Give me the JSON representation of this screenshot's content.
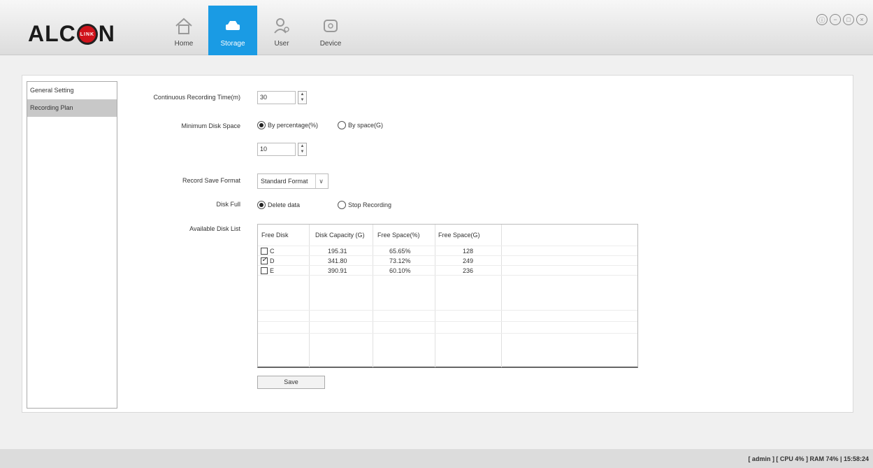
{
  "logo": {
    "brand_left": "ALC",
    "brand_inner": "LINK",
    "brand_right": "N"
  },
  "nav": [
    {
      "label": "Home",
      "icon": "home-icon",
      "active": false
    },
    {
      "label": "Storage",
      "icon": "storage-icon",
      "active": true
    },
    {
      "label": "User",
      "icon": "user-icon",
      "active": false
    },
    {
      "label": "Device",
      "icon": "device-icon",
      "active": false
    }
  ],
  "window_controls": [
    "info-icon",
    "minimize-icon",
    "maximize-icon",
    "close-icon"
  ],
  "sidebar": {
    "items": [
      {
        "label": "General Setting",
        "active": false
      },
      {
        "label": "Recording Plan",
        "active": true
      }
    ]
  },
  "form": {
    "continuous_label": "Continuous Recording Time(m)",
    "continuous_value": "30",
    "min_disk_label": "Minimum Disk Space",
    "min_disk_opt1": "By percentage(%)",
    "min_disk_opt2": "By space(G)",
    "min_disk_value": "10",
    "format_label": "Record Save Format",
    "format_value": "Standard Format",
    "disk_full_label": "Disk Full",
    "disk_full_opt1": "Delete data",
    "disk_full_opt2": "Stop Recording",
    "disk_list_label": "Available Disk List"
  },
  "disk_table": {
    "headers": [
      "Free Disk",
      "Disk Capacity (G)",
      "Free Space(%)",
      "Free Space(G)"
    ],
    "rows": [
      {
        "disk": "C",
        "checked": false,
        "capacity": "195.31",
        "free_pct": "65.65%",
        "free_g": "128"
      },
      {
        "disk": "D",
        "checked": true,
        "capacity": "341.80",
        "free_pct": "73.12%",
        "free_g": "249"
      },
      {
        "disk": "E",
        "checked": false,
        "capacity": "390.91",
        "free_pct": "60.10%",
        "free_g": "236"
      }
    ]
  },
  "save_label": "Save",
  "status": "[ admin ] [ CPU 4% ] RAM 74% | 15:58:24"
}
